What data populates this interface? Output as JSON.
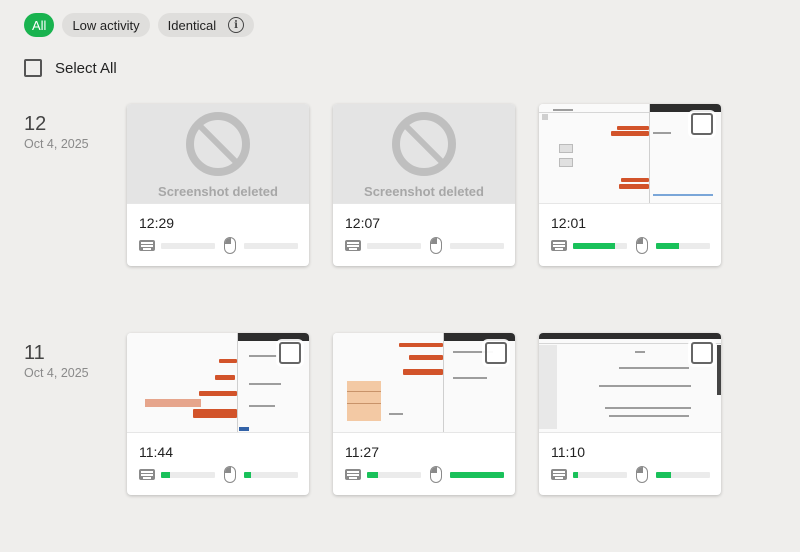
{
  "filters": [
    {
      "label": "All",
      "active": true
    },
    {
      "label": "Low activity",
      "active": false
    },
    {
      "label": "Identical",
      "active": false,
      "info_icon": "info-icon"
    }
  ],
  "select_all": {
    "label": "Select All",
    "checked": false
  },
  "accent_color": "#19c15a",
  "groups": [
    {
      "hour": "12",
      "date": "Oct 4, 2025",
      "cards": [
        {
          "time": "12:29",
          "deleted": true,
          "deleted_label": "Screenshot deleted",
          "keyboard_activity": 0,
          "mouse_activity": 0
        },
        {
          "time": "12:07",
          "deleted": true,
          "deleted_label": "Screenshot deleted",
          "keyboard_activity": 0,
          "mouse_activity": 0
        },
        {
          "time": "12:01",
          "deleted": false,
          "keyboard_activity": 0.78,
          "mouse_activity": 0.42
        }
      ]
    },
    {
      "hour": "11",
      "date": "Oct 4, 2025",
      "cards": [
        {
          "time": "11:44",
          "deleted": false,
          "keyboard_activity": 0.17,
          "mouse_activity": 0.13
        },
        {
          "time": "11:27",
          "deleted": false,
          "keyboard_activity": 0.2,
          "mouse_activity": 1.0
        },
        {
          "time": "11:10",
          "deleted": false,
          "keyboard_activity": 0.1,
          "mouse_activity": 0.28
        }
      ]
    }
  ]
}
